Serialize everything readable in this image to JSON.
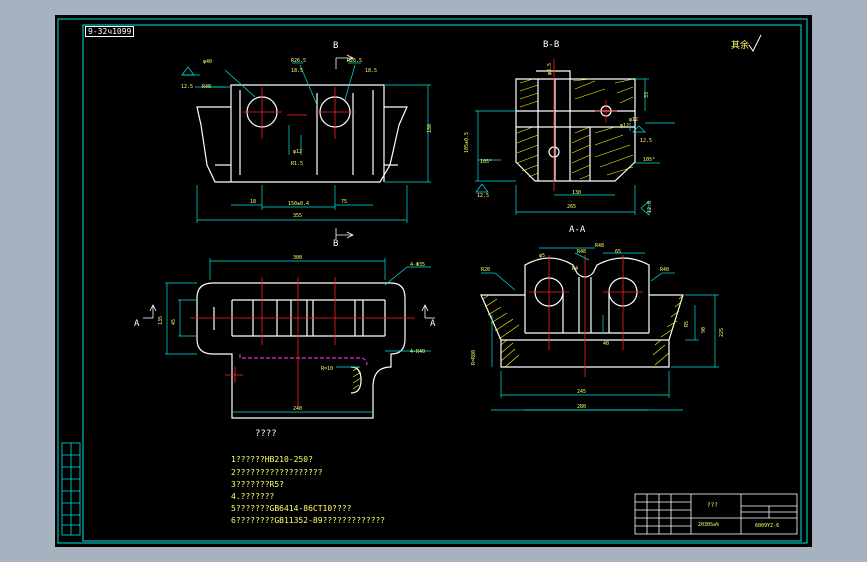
{
  "drawing_code": "9-32ч1099",
  "section_labels": {
    "b_top": "B",
    "b_bottom": "B",
    "bb": "B-B",
    "aa": "A-A",
    "a_left": "A",
    "a_right": "A"
  },
  "roughness_mark": "其余",
  "notes": {
    "heading": "????",
    "lines": [
      "1??????HB210-250?",
      "2??????????????????",
      "3???????R5?",
      "4.???????",
      "5???????GB6414-86CT10????",
      "6????????GB11352-89?????????????"
    ]
  },
  "title_block": {
    "middle_text": "???",
    "scale_label": "2030Sa%",
    "code": "6009YZ-6"
  },
  "colors": {
    "outline": "#ffffff",
    "dimension": "#00ffff",
    "centerline": "#ff2020",
    "hidden": "#ff40ff",
    "hatch": "#ffff00",
    "border": "#00ffff"
  }
}
